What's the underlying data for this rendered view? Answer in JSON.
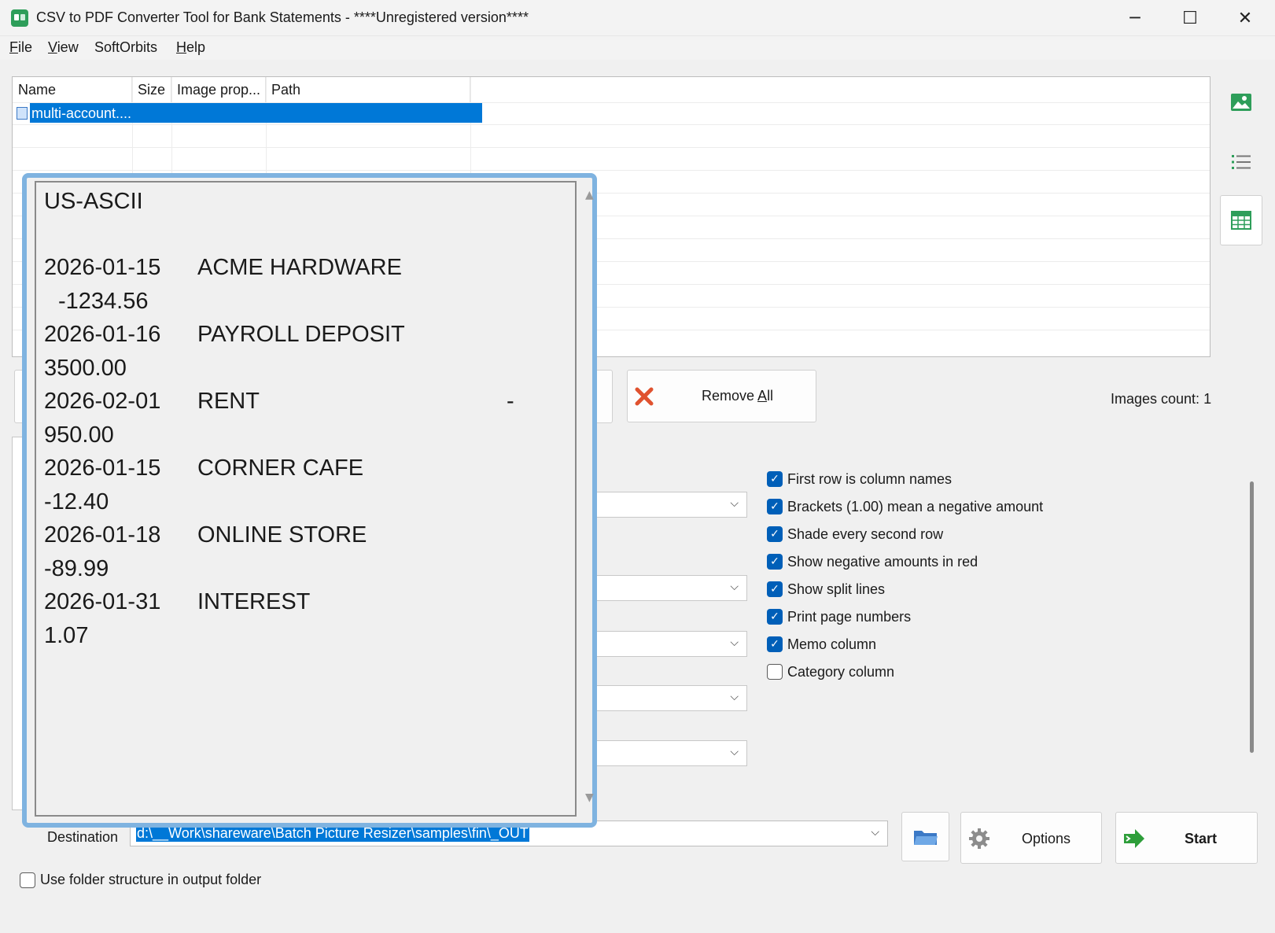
{
  "window": {
    "title": "CSV to PDF Converter Tool for Bank Statements - ****Unregistered version****",
    "minimize_glyph": "─",
    "maximize_glyph": "☐",
    "close_glyph": "✕"
  },
  "menu": {
    "file": {
      "u": "F",
      "rest": "ile"
    },
    "view": {
      "u": "V",
      "rest": "iew"
    },
    "softorbits": "SoftOrbits",
    "help": {
      "u": "H",
      "rest": "elp"
    }
  },
  "file_table": {
    "columns": [
      "Name",
      "Size",
      "Image prop...",
      "Path"
    ],
    "rows": [
      {
        "name": "multi-account....",
        "size": "",
        "image_properties": "",
        "path": ""
      }
    ]
  },
  "side_tools": [
    "image-icon",
    "list-icon",
    "table-icon"
  ],
  "buttons": {
    "remove_all": {
      "pre": "Remove ",
      "u": "A",
      "post": "ll"
    },
    "options": "Options",
    "start": "Start"
  },
  "images_count": "Images count: 1",
  "checkboxes": [
    {
      "label": "First row is column names",
      "checked": true
    },
    {
      "label": "Brackets (1.00) mean a negative amount",
      "checked": true
    },
    {
      "label": "Shade every second row",
      "checked": true
    },
    {
      "label": "Show negative amounts in red",
      "checked": true
    },
    {
      "label": "Show split lines",
      "checked": true
    },
    {
      "label": "Print page numbers",
      "checked": true
    },
    {
      "label": "Memo column",
      "checked": true
    },
    {
      "label": "Category column",
      "checked": false
    }
  ],
  "destination": {
    "label": "Destination",
    "value": "d:\\__Work\\shareware\\Batch Picture Resizer\\samples\\fin\\_OUT"
  },
  "use_folder_structure": {
    "label": "Use folder structure in output folder",
    "checked": false
  },
  "popup": {
    "lines": [
      "US-ASCII",
      "2026-01-15",
      "ACME HARDWARE",
      "-1234.56",
      "2026-01-16",
      "PAYROLL DEPOSIT",
      "3500.00",
      "2026-02-01",
      "RENT",
      "-",
      "950.00",
      "2026-01-15",
      "CORNER CAFE",
      "-12.40",
      "2026-01-18",
      "ONLINE STORE",
      "-89.99",
      "2026-01-31",
      "INTEREST",
      "1.07"
    ]
  }
}
